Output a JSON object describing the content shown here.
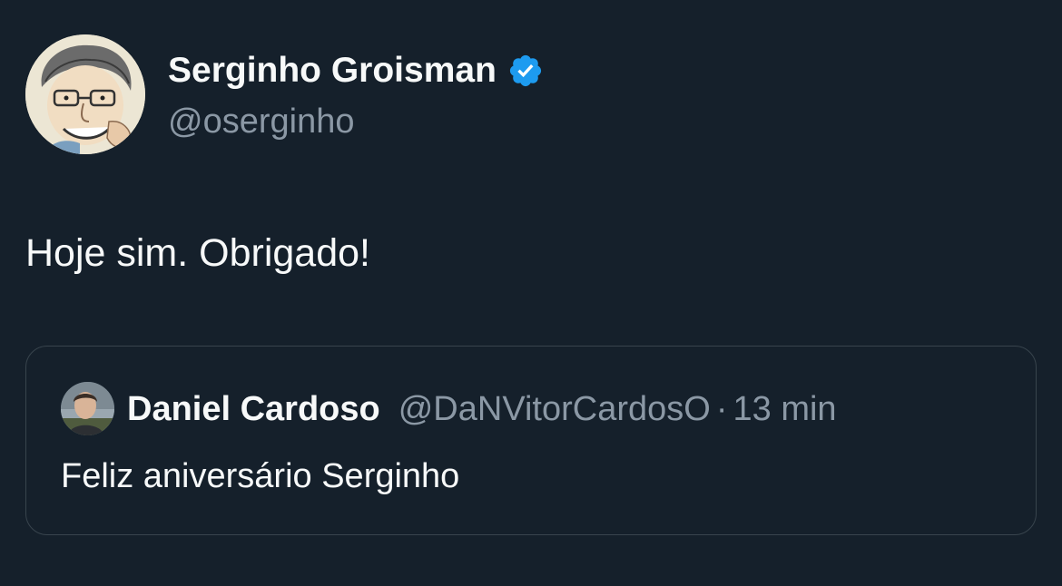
{
  "author": {
    "name": "Serginho Groisman",
    "handle": "@oserginho",
    "verified": true,
    "verified_color": "#1d9bf0"
  },
  "tweet": {
    "text": "Hoje sim. Obrigado!"
  },
  "quoted_tweet": {
    "author_name": "Daniel Cardoso",
    "author_handle": "@DaNVitorCardosO",
    "separator": "·",
    "time": "13 min",
    "text": "Feliz aniversário Serginho"
  },
  "colors": {
    "background": "#15202b",
    "primary_text": "#f7f9f9",
    "secondary_text": "#8b98a5",
    "border": "#38444d"
  }
}
